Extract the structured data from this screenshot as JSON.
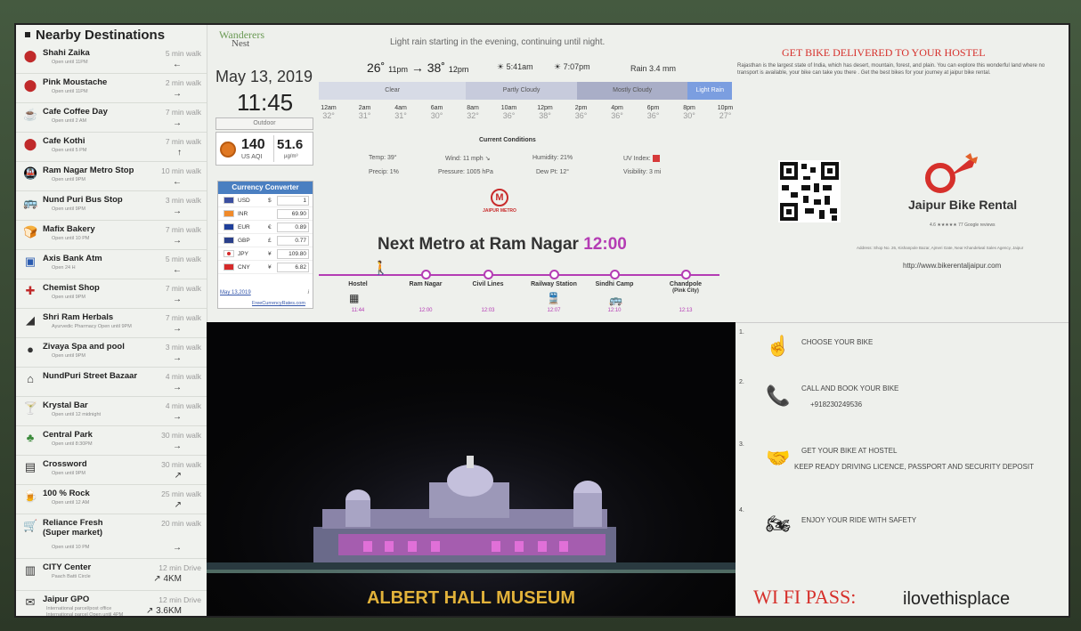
{
  "destinations": {
    "title": "Nearby  Destinations",
    "items": [
      {
        "name": "Shahi Zaika",
        "sub": "Open until 11PM",
        "walk": "5 min walk",
        "arrow": "←",
        "icon": "location-pin-icon"
      },
      {
        "name": "Pink Moustache",
        "sub": "Open until 11PM",
        "walk": "2 min walk",
        "arrow": "→",
        "icon": "location-pin-icon"
      },
      {
        "name": "Cafe Coffee Day",
        "sub": "Open until 2 AM",
        "walk": "7 min walk",
        "arrow": "→",
        "icon": "coffee-cup-icon"
      },
      {
        "name": "Cafe Kothi",
        "sub": "Open until 5 PM",
        "walk": "7 min walk",
        "arrow": "↑",
        "icon": "location-pin-icon"
      },
      {
        "name": "Ram Nagar Metro Stop",
        "sub": "Open until 9PM",
        "walk": "10 min walk",
        "arrow": "←",
        "icon": "metro-train-icon"
      },
      {
        "name": "Nund Puri Bus Stop",
        "sub": "Open until 9PM",
        "walk": "3 min walk",
        "arrow": "→",
        "icon": "bus-icon"
      },
      {
        "name": "Mafix Bakery",
        "sub": "Open until 10 PM",
        "walk": "7 min walk",
        "arrow": "→",
        "icon": "bread-icon"
      },
      {
        "name": "Axis Bank Atm",
        "sub": "Open 24 H",
        "walk": "5 min walk",
        "arrow": "←",
        "icon": "atm-icon"
      },
      {
        "name": "Chemist Shop",
        "sub": "Open until 9PM",
        "walk": "7 min walk",
        "arrow": "→",
        "icon": "pharmacy-icon"
      },
      {
        "name": "Shri Ram Herbals",
        "sub": "Ayurvedic Pharmacy Open until 9PM",
        "walk": "7 min walk",
        "arrow": "→",
        "icon": "mortar-icon"
      },
      {
        "name": "Zivaya Spa and pool",
        "sub": "Open until 9PM",
        "walk": "3 min walk",
        "arrow": "→",
        "icon": "spa-stones-icon"
      },
      {
        "name": "NundPuri  Street Bazaar",
        "sub": "",
        "walk": "4 min walk",
        "arrow": "→",
        "icon": "market-stall-icon"
      },
      {
        "name": "Krystal Bar",
        "sub": "Open until 12 midnight",
        "walk": "4 min walk",
        "arrow": "→",
        "icon": "cocktail-icon"
      },
      {
        "name": "Central Park",
        "sub": "Open until 8:30PM",
        "walk": "30 min walk",
        "arrow": "→",
        "icon": "park-bench-icon"
      },
      {
        "name": "Crossword",
        "sub": "Open until 9PM",
        "walk": "30 min walk",
        "arrow": "↗",
        "icon": "bookstore-icon"
      },
      {
        "name": "100 % Rock",
        "sub": "Open until 12 AM",
        "walk": "25 min walk",
        "arrow": "↗",
        "icon": "beer-mug-icon"
      },
      {
        "name": "Reliance Fresh (Super market)",
        "sub": "Open until 10 PM",
        "walk": "20 min walk",
        "arrow": "→",
        "icon": "shopping-cart-icon"
      },
      {
        "name": "CITY Center",
        "sub": "Paach Batti Circle",
        "walk": "12 min Drive",
        "arrow": "↗ 4KM",
        "icon": "building-icon"
      },
      {
        "name": "Jaipur GPO",
        "sub": "International parcel/post office",
        "sub2": "International parcel Open until 4PM",
        "walk": "12 min Drive",
        "arrow": "↗ 3.6KM",
        "icon": "post-office-icon"
      }
    ]
  },
  "brand": {
    "line1": "Wanderers",
    "line2": "Nest"
  },
  "clock": {
    "date": "May 13, 2019",
    "time": "11:45"
  },
  "air": {
    "outdoor": "Outdoor",
    "aqi": "140",
    "aqi_label": "US AQI",
    "pm": "51.6",
    "pm_unit": "µg/m³"
  },
  "currency": {
    "title": "Currency Converter",
    "rows": [
      {
        "code": "USD",
        "symbol": "$",
        "value": "1",
        "flag": "us-flag-icon"
      },
      {
        "code": "INR",
        "symbol": "",
        "value": "69.90",
        "flag": "india-flag-icon"
      },
      {
        "code": "EUR",
        "symbol": "€",
        "value": "0.89",
        "flag": "eu-flag-icon"
      },
      {
        "code": "GBP",
        "symbol": "£",
        "value": "0.77",
        "flag": "uk-flag-icon"
      },
      {
        "code": "JPY",
        "symbol": "¥",
        "value": "109.80",
        "flag": "japan-flag-icon"
      },
      {
        "code": "CNY",
        "symbol": "¥",
        "value": "6.82",
        "flag": "china-flag-icon"
      }
    ],
    "date": "May 13,2019",
    "info": "i",
    "link": "FreeCurrencyRates.com"
  },
  "weather": {
    "forecast": "Light rain starting in the evening, continuing until night.",
    "low": "26˚",
    "low_time": "11pm",
    "arrow": "→",
    "high": "38˚",
    "high_time": "12pm",
    "sunrise": "5:41am",
    "sunset": "7:07pm",
    "rain": "Rain 3.4 mm",
    "conditions": [
      {
        "label": "Clear",
        "color": "#d7dbe6",
        "flex": 150
      },
      {
        "label": "Partly Cloudy",
        "color": "#c7cbdc",
        "flex": 113
      },
      {
        "label": "Mostly Cloudy",
        "color": "#a9aec7",
        "flex": 113
      },
      {
        "label": "Light Rain",
        "color": "#7b9ee0",
        "flex": 45
      }
    ],
    "hours": [
      {
        "l": "12am",
        "t": "32°"
      },
      {
        "l": "2am",
        "t": "31°"
      },
      {
        "l": "4am",
        "t": "31°"
      },
      {
        "l": "6am",
        "t": "30°"
      },
      {
        "l": "8am",
        "t": "32°"
      },
      {
        "l": "10am",
        "t": "36°"
      },
      {
        "l": "12pm",
        "t": "38°"
      },
      {
        "l": "2pm",
        "t": "36°"
      },
      {
        "l": "4pm",
        "t": "36°"
      },
      {
        "l": "6pm",
        "t": "36°"
      },
      {
        "l": "8pm",
        "t": "30°"
      },
      {
        "l": "10pm",
        "t": "27°"
      }
    ],
    "current_title": "Current Conditions",
    "temp": "Temp: 39°",
    "wind": "Wind: 11 mph ↘",
    "humidity": "Humidity: 21%",
    "uv": "UV Index:",
    "precip": "Precip: 1%",
    "pressure": "Pressure: 1005 hPa",
    "dew": "Dew Pt: 12°",
    "visibility": "Visibility: 3 mi"
  },
  "metro": {
    "logo_text": "JAIPUR METRO",
    "heading": "Next Metro at Ram Nagar",
    "time": "12:00",
    "stations": [
      {
        "name": "Hostel",
        "time": "11:44"
      },
      {
        "name": "Ram Nagar",
        "time": "12:00"
      },
      {
        "name": "Civil Lines",
        "time": "12:03"
      },
      {
        "name": "Railway Station",
        "time": "12:07"
      },
      {
        "name": "Sindhi Camp",
        "time": "12:10"
      },
      {
        "name": "Chandpole",
        "name2": "(Pink City)",
        "time": "12:13"
      }
    ]
  },
  "museum": {
    "title": "ALBERT HALL MUSEUM"
  },
  "promo": {
    "title": "GET BIKE DELIVERED  TO YOUR HOSTEL",
    "text": "Rajasthan is the largest state of India, which has desert, mountain, forest, and plain. You can explore this wonderful land where no transport is available, your bike can take you there . Get the best bikes for your journey at jaipur bike rental.",
    "company": "Jaipur  Bike Rental",
    "rating": "4.6 ★★★★★  77 Google reviews",
    "address": "Address: Shop No. 26, Kishanpole Bazar, Ajmeri Gate, Near Khandelwal Sales Agency, Jaipur",
    "site": "http://www.bikerentaljaipur.com"
  },
  "steps": [
    {
      "n": "1.",
      "text": "CHOOSE YOUR BIKE",
      "icon": "hand-tap-icon"
    },
    {
      "n": "2.",
      "text": "CALL AND BOOK YOUR BIKE",
      "text2": "+918230249536",
      "icon": "phone-icon"
    },
    {
      "n": "3.",
      "text": "GET YOUR BIKE AT HOSTEL",
      "text2": "KEEP READY  DRIVING LICENCE, PASSPORT AND SECURITY DEPOSIT",
      "icon": "handover-icon"
    },
    {
      "n": "4.",
      "text": "ENJOY YOUR RIDE WITH SAFETY",
      "icon": "motorbike-icon"
    }
  ],
  "wifi": {
    "label": "WI FI PASS:",
    "password": "ilovethisplace"
  }
}
